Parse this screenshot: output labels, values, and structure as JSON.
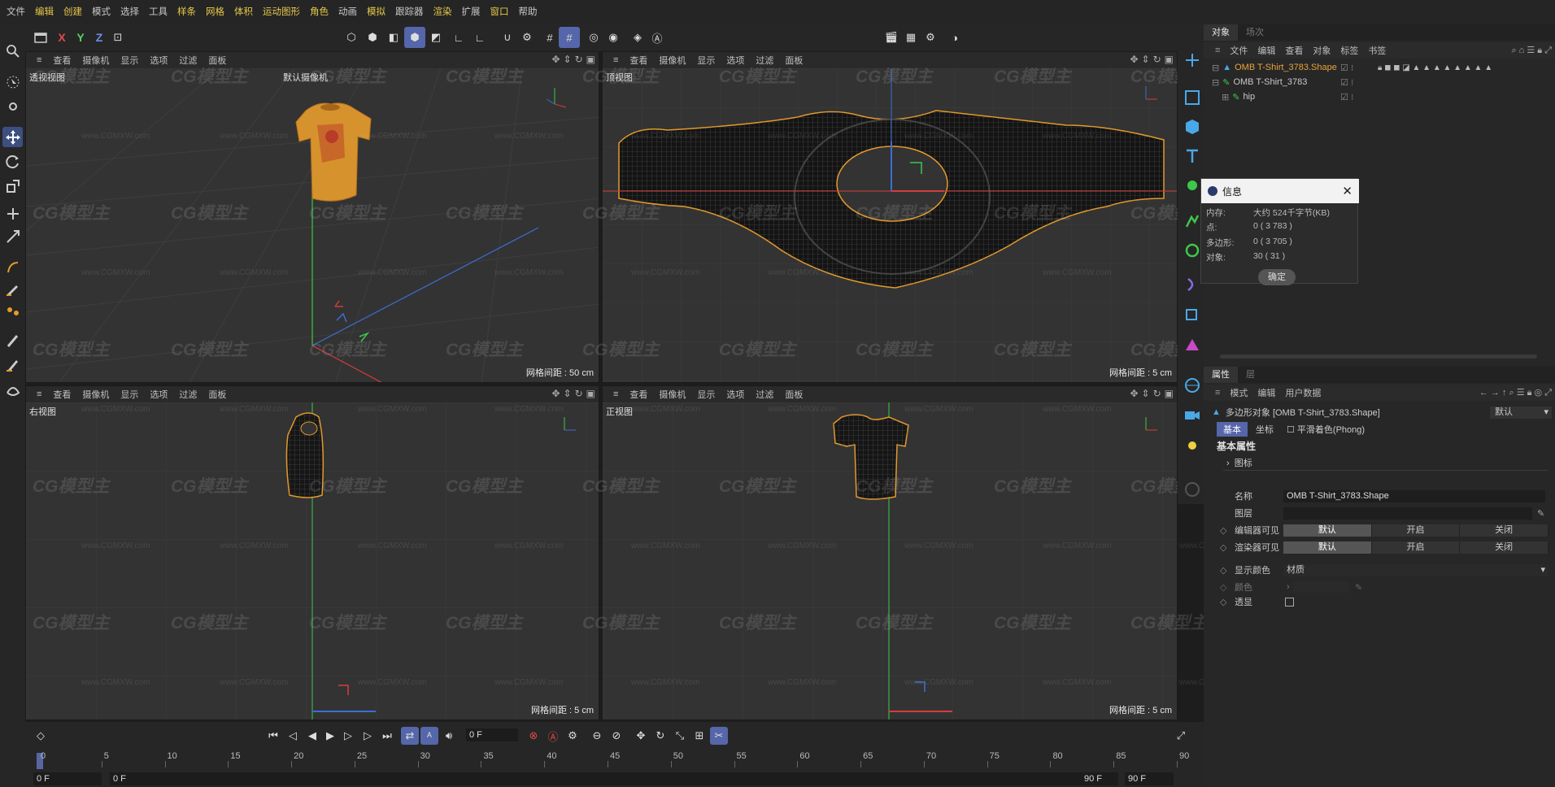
{
  "menubar": {
    "items": [
      {
        "label": "文件",
        "hl": false
      },
      {
        "label": "编辑",
        "hl": true
      },
      {
        "label": "创建",
        "hl": true
      },
      {
        "label": "模式",
        "hl": false
      },
      {
        "label": "选择",
        "hl": false
      },
      {
        "label": "工具",
        "hl": false
      },
      {
        "label": "样条",
        "hl": true
      },
      {
        "label": "网格",
        "hl": true
      },
      {
        "label": "体积",
        "hl": true
      },
      {
        "label": "运动图形",
        "hl": true
      },
      {
        "label": "角色",
        "hl": true
      },
      {
        "label": "动画",
        "hl": false
      },
      {
        "label": "模拟",
        "hl": true
      },
      {
        "label": "跟踪器",
        "hl": false
      },
      {
        "label": "渲染",
        "hl": true
      },
      {
        "label": "扩展",
        "hl": false
      },
      {
        "label": "窗口",
        "hl": true
      },
      {
        "label": "帮助",
        "hl": false
      }
    ]
  },
  "toolbar": {
    "axis_x": "X",
    "axis_y": "Y",
    "axis_z": "Z"
  },
  "left_tooltip": "移动",
  "viewports": {
    "menu": [
      "查看",
      "摄像机",
      "显示",
      "选项",
      "过滤",
      "面板"
    ],
    "perspective": {
      "name": "透视视图",
      "camera": "默认摄像机",
      "grid": "网格间距 : 50 cm"
    },
    "top": {
      "name": "顶视图",
      "grid": "网格间距 : 5 cm"
    },
    "right": {
      "name": "右视图",
      "grid": "网格间距 : 5 cm"
    },
    "front": {
      "name": "正视图",
      "grid": "网格间距 : 5 cm"
    }
  },
  "watermark": {
    "brand": "CG模型主",
    "url": "www.CGMXW.com"
  },
  "info_dialog": {
    "title": "信息",
    "rows": [
      {
        "k": "内存:",
        "v": "大约 524千字节(KB)"
      },
      {
        "k": "点:",
        "v": "0 ( 3 783 )"
      },
      {
        "k": "多边形:",
        "v": "0 ( 3 705 )"
      },
      {
        "k": "对象:",
        "v": "30 ( 31 )"
      }
    ],
    "ok": "确定"
  },
  "objects_panel": {
    "tabs": [
      "对象",
      "场次"
    ],
    "menu": [
      "文件",
      "编辑",
      "查看",
      "对象",
      "标签",
      "书签"
    ],
    "items": [
      {
        "name": "OMB T-Shirt_3783.Shape",
        "color": "#e6a33b"
      },
      {
        "name": "OMB T-Shirt_3783",
        "color": "#c8c8c8"
      },
      {
        "name": "hip",
        "color": "#c8c8c8"
      }
    ]
  },
  "attributes_panel": {
    "tabs": [
      "属性",
      "层"
    ],
    "menu": [
      "模式",
      "编辑",
      "用户数据"
    ],
    "object_title": "多边形对象 [OMB T-Shirt_3783.Shape]",
    "preset": "默认",
    "subtabs": [
      "基本",
      "坐标",
      "平滑着色(Phong)"
    ],
    "section": "基本属性",
    "icon_group": "图标",
    "rows": {
      "name_label": "名称",
      "name_value": "OMB T-Shirt_3783.Shape",
      "layer_label": "图层",
      "editor_vis_label": "编辑器可见",
      "render_vis_label": "渲染器可见",
      "vis_options": [
        "默认",
        "开启",
        "关闭"
      ],
      "display_color_label": "显示颜色",
      "display_color_value": "材质",
      "color_label": "颜色",
      "xray_label": "透显"
    }
  },
  "timeline": {
    "current_frame": "0 F",
    "start_field": "0 F",
    "start_field2": "0 F",
    "end_field": "90 F",
    "end_field2": "90 F",
    "ticks": [
      0,
      5,
      10,
      15,
      20,
      25,
      30,
      35,
      40,
      45,
      50,
      55,
      60,
      65,
      70,
      75,
      80,
      85,
      90
    ]
  },
  "colors": {
    "accent": "#5566aa",
    "selection": "#e69b2b",
    "axis_x": "#d43c3c",
    "axis_y": "#3cc84a",
    "axis_z": "#3c6ed4"
  }
}
